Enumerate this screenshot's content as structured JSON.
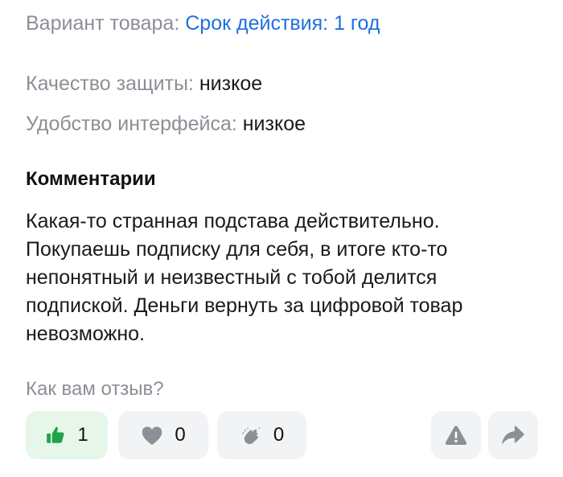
{
  "review": {
    "variant_label": "Вариант товара:",
    "variant_value": "Срок действия: 1 год",
    "quality_label": "Качество защиты:",
    "quality_value": "низкое",
    "usability_label": "Удобство интерфейса:",
    "usability_value": "низкое",
    "comments_title": "Комментарии",
    "comment_lines": [
      "Какая-то странная подстава действительно.",
      "Покупаешь подписку для себя, в итоге кто-то",
      "непонятный и неизвестный с тобой делится",
      "подпиской. Деньги вернуть за цифровой товар",
      "невозможно."
    ]
  },
  "feedback": {
    "prompt": "Как вам отзыв?",
    "reactions": {
      "like": {
        "icon": "thumbs-up-icon",
        "count": "1",
        "color": "#1fa34a"
      },
      "heart": {
        "icon": "heart-icon",
        "count": "0",
        "color": "#8c8f96"
      },
      "clap": {
        "icon": "clapping-hands-icon",
        "count": "0",
        "color": "#8c8f96"
      }
    },
    "actions": {
      "report_icon": "warning-icon",
      "share_icon": "share-arrow-icon"
    }
  }
}
